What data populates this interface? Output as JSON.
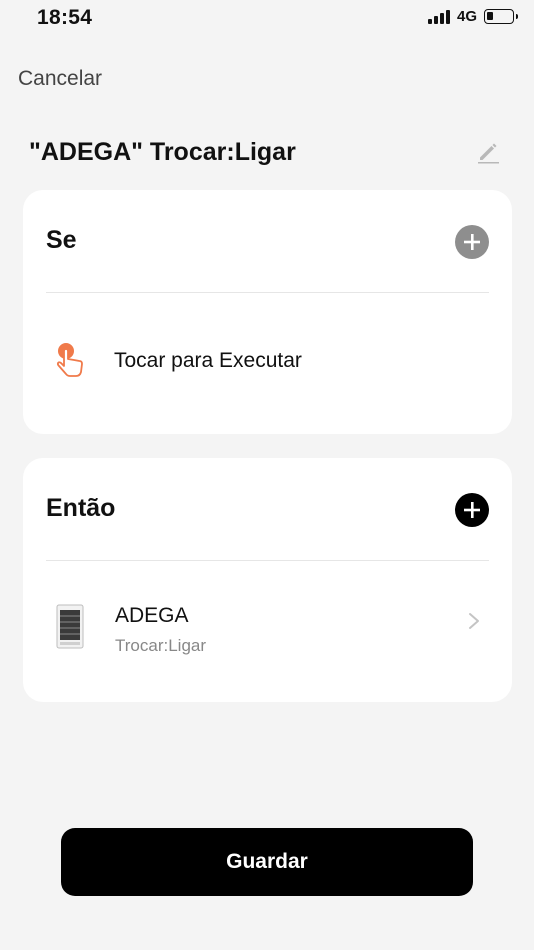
{
  "status_bar": {
    "time": "18:54",
    "network": "4G"
  },
  "nav": {
    "cancel_label": "Cancelar"
  },
  "scene": {
    "title": "\"ADEGA\" Trocar:Ligar"
  },
  "if_section": {
    "header": "Se",
    "condition": {
      "label": "Tocar para Executar",
      "icon": "tap-hand-icon"
    }
  },
  "then_section": {
    "header": "Então",
    "action": {
      "device_name": "ADEGA",
      "action_label": "Trocar:Ligar",
      "icon": "wine-cooler-icon"
    }
  },
  "footer": {
    "save_label": "Guardar"
  },
  "colors": {
    "accent_orange": "#f07a4a",
    "button_black": "#000000",
    "add_grey": "#8e8e8e"
  }
}
